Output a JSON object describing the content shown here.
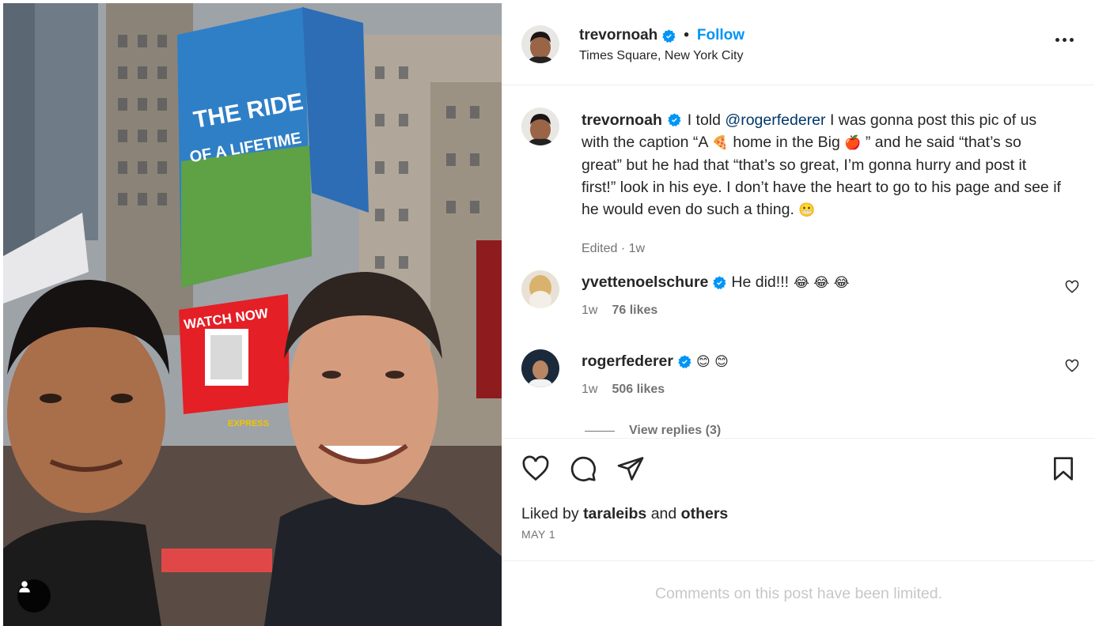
{
  "colors": {
    "accent": "#0095f6",
    "verified": "#0095f6",
    "mention": "#00376b",
    "muted": "#737373"
  },
  "photo": {
    "billboard_title": "THE RIDE",
    "billboard_subtitle": "OF A LIFETIME",
    "watch_now": "WATCH NOW",
    "express": "EXPRESS",
    "user_tag_icon": "person-icon"
  },
  "header": {
    "username": "trevornoah",
    "separator": "•",
    "follow_label": "Follow",
    "location": "Times Square, New York City",
    "more_icon": "more-options-icon"
  },
  "caption": {
    "username": "trevornoah",
    "text_1": "I told",
    "mention": "@rogerfederer",
    "text_2": "I was gonna post this pic of us with the caption “A",
    "emoji_pizza": "🍕",
    "text_3": "home in the Big",
    "emoji_apple": "🍎",
    "text_4": "” and he said “that’s so great” but he had that “that’s so great, I’m gonna hurry and post it first!” look in his eye. I don’t have the heart to go to his page and see if he would even do such a thing.",
    "emoji_end": "😬",
    "meta": "Edited · 1w"
  },
  "comments": [
    {
      "username": "yvettenoelschure",
      "text": "He did!!!",
      "emojis": "😂 😂 😂",
      "time": "1w",
      "likes": "76 likes"
    },
    {
      "username": "rogerfederer",
      "text": "",
      "emojis": "😊 😊",
      "time": "1w",
      "likes": "506 likes"
    }
  ],
  "view_replies": "View replies (3)",
  "actions": {
    "like_icon": "heart-icon",
    "comment_icon": "comment-icon",
    "share_icon": "share-icon",
    "save_icon": "bookmark-icon"
  },
  "likes": {
    "prefix": "Liked by",
    "user": "taraleibs",
    "and": "and",
    "others": "others"
  },
  "date": "MAY 1",
  "limited_notice": "Comments on this post have been limited."
}
